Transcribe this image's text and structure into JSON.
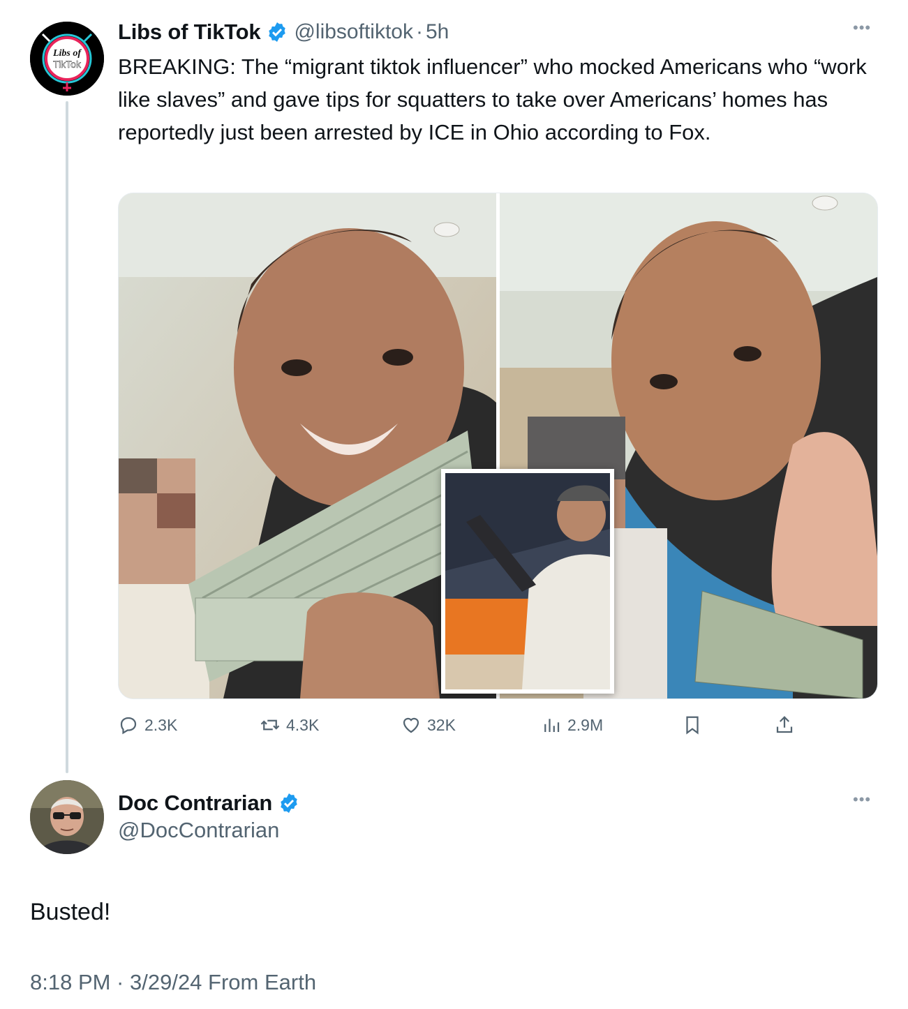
{
  "parent_tweet": {
    "display_name": "Libs of TikTok",
    "handle": "@libsoftiktok",
    "separator": "·",
    "time_ago": "5h",
    "avatar_text_line1": "Libs of",
    "avatar_text_line2": "TikTok",
    "text": "BREAKING: The “migrant tiktok influencer” who mocked Americans who “work like slaves” and gave tips for squatters to take over Americans’ homes has reportedly just been arrested by ICE in Ohio according to Fox.",
    "more_icon": "more-dots-icon",
    "actions": {
      "replies": "2.3K",
      "reposts": "4.3K",
      "likes": "32K",
      "views": "2.9M"
    }
  },
  "reply_tweet": {
    "display_name": "Doc Contrarian",
    "handle": "@DocContrarian",
    "text": "Busted!",
    "meta": "8:18 PM · 3/29/24 From Earth",
    "more_icon": "more-dots-icon"
  },
  "colors": {
    "text_primary": "#0f1419",
    "text_secondary": "#536471",
    "verified_blue": "#1d9bf0",
    "thread_line": "#cfd9de"
  }
}
